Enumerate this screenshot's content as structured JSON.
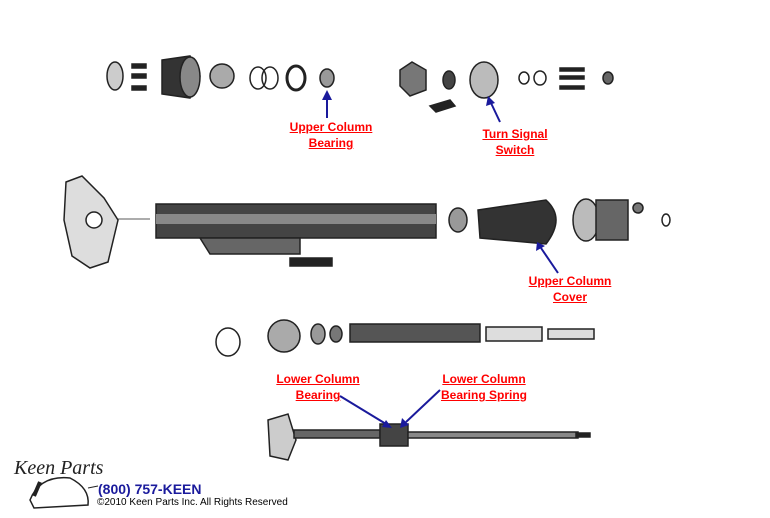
{
  "labels": [
    {
      "id": "upper-column-bearing",
      "line1": "Upper Column",
      "line2": "Bearing"
    },
    {
      "id": "turn-signal-switch",
      "line1": "Turn Signal",
      "line2": "Switch"
    },
    {
      "id": "upper-column-cover",
      "line1": "Upper Column",
      "line2": "Cover"
    },
    {
      "id": "lower-column-bearing",
      "line1": "Lower Column",
      "line2": "Bearing"
    },
    {
      "id": "lower-column-bearing-spring",
      "line1": "Lower Column",
      "line2": "Bearing Spring"
    }
  ],
  "footer": {
    "logo_text": "Keen Parts",
    "phone": "(800) 757-KEEN",
    "copyright": "©2010 Keen Parts Inc. All Rights Reserved"
  },
  "colors": {
    "label": "#ff0000",
    "arrow": "#1a1a9c",
    "parts": "#222222"
  }
}
